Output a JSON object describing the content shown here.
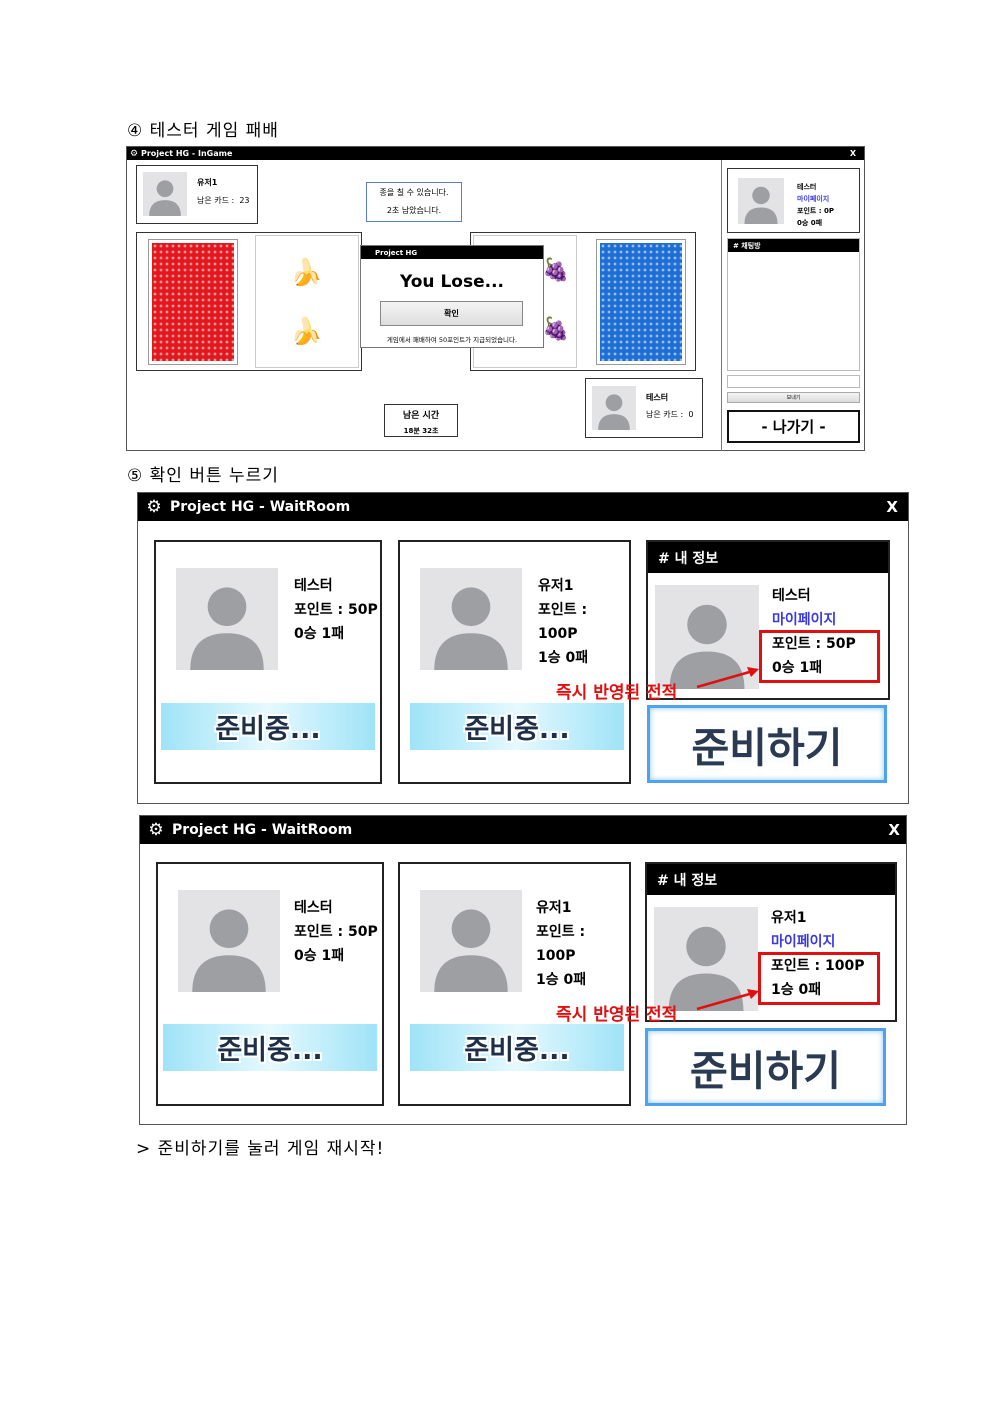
{
  "step4": {
    "heading": "④ 테스터 게임 패배"
  },
  "ingame": {
    "title": "Project HG - InGame",
    "close": "X",
    "opponent": {
      "name": "유저1",
      "cards_label": "남은 카드 :",
      "cards_value": "23"
    },
    "notice": {
      "line1": "종을 칠 수 있습니다.",
      "line2": "2초 남았습니다."
    },
    "dialog": {
      "title": "Project HG",
      "message": "You Lose...",
      "confirm": "확인",
      "footer": "게임에서 패배하여 50포인트가 지급되었습니다."
    },
    "timer": {
      "label": "남은 시간",
      "value": "18분 32초"
    },
    "player": {
      "name": "테스터",
      "cards_label": "남은 카드 :",
      "cards_value": "0"
    },
    "sidebar": {
      "name": "테스터",
      "mypage": "마이페이지",
      "points": "포인트 : 0P",
      "record": "0승 0패",
      "chat_header": "# 채팅방",
      "send": "보내기",
      "exit": "- 나가기 -"
    }
  },
  "step5": {
    "heading": "⑤ 확인 버튼 누르기"
  },
  "waitroom1": {
    "title": "Project HG - WaitRoom",
    "close": "X",
    "slots": [
      {
        "name": "테스터",
        "points": "포인트 : 50P",
        "record": "0승 1패",
        "status": "준비중..."
      },
      {
        "name": "유저1",
        "points": "포인트 : 100P",
        "record": "1승 0패",
        "status": "준비중..."
      }
    ],
    "myinfo": {
      "header": "# 내 정보",
      "name": "테스터",
      "mypage": "마이페이지",
      "points": "포인트 : 50P",
      "record": "0승 1패"
    },
    "annotation": "즉시 반영된 전적",
    "ready": "준비하기"
  },
  "waitroom2": {
    "title": "Project HG - WaitRoom",
    "close": "X",
    "slots": [
      {
        "name": "테스터",
        "points": "포인트 : 50P",
        "record": "0승 1패",
        "status": "준비중..."
      },
      {
        "name": "유저1",
        "points": "포인트 : 100P",
        "record": "1승 0패",
        "status": "준비중..."
      }
    ],
    "myinfo": {
      "header": "# 내 정보",
      "name": "유저1",
      "mypage": "마이페이지",
      "points": "포인트 : 100P",
      "record": "1승 0패"
    },
    "annotation": "즉시 반영된 전적",
    "ready": "준비하기"
  },
  "footer_note": "> 준비하기를 눌러 게임 재시작!",
  "icons": {
    "gear": "gear-icon",
    "avatar": "user-avatar-icon",
    "banana": "banana-icon",
    "grape": "grape-icon",
    "arrow": "arrow-icon"
  },
  "colors": {
    "titlebar": "#000000",
    "red_card": "#e3181e",
    "blue_card": "#1d6fd6",
    "highlight": "#e01010",
    "mypage": "#3a3ae0",
    "ready_border": "#4ea3ec"
  }
}
